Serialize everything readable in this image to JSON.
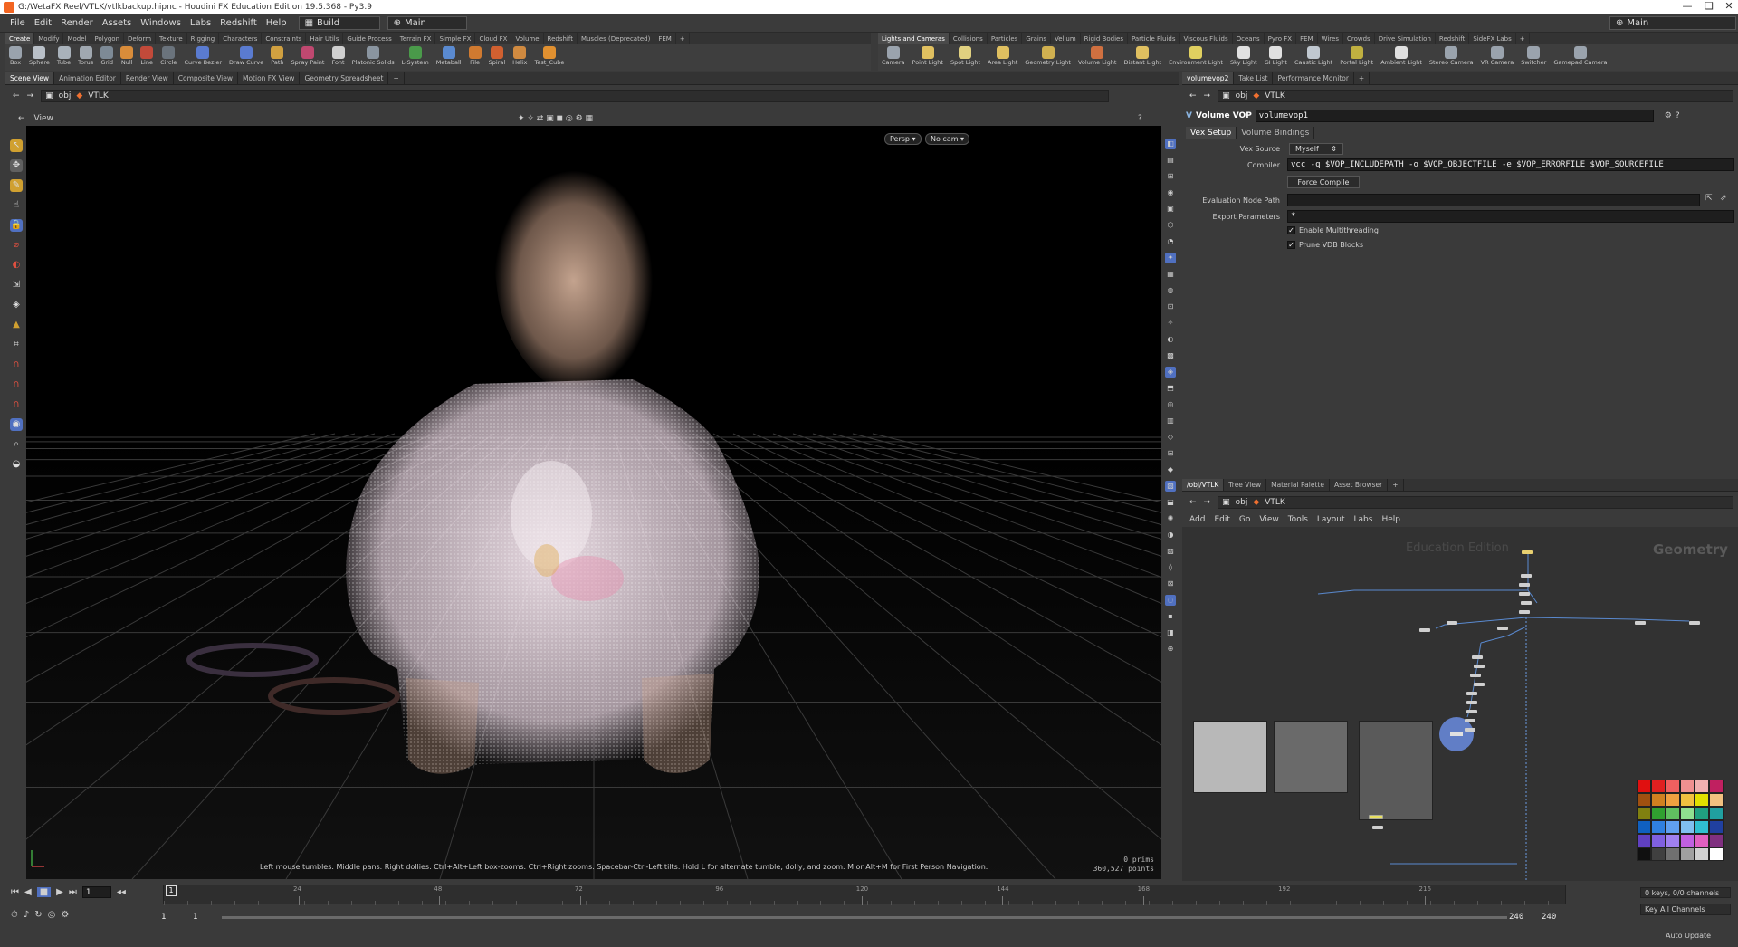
{
  "window": {
    "title": "G:/WetaFX Reel/VTLK/vtlkbackup.hipnc - Houdini FX Education Edition 19.5.368 - Py3.9",
    "controls": [
      "—",
      "❏",
      "✕"
    ]
  },
  "menubar": {
    "items": [
      "File",
      "Edit",
      "Render",
      "Assets",
      "Windows",
      "Labs",
      "Redshift",
      "Help"
    ],
    "desktop": "Build",
    "main": "Main",
    "main_right": "Main"
  },
  "shelf_tabs_left": [
    "Create",
    "Modify",
    "Model",
    "Polygon",
    "Deform",
    "Texture",
    "Rigging",
    "Characters",
    "Constraints",
    "Hair Utils",
    "Guide Process",
    "Terrain FX",
    "Simple FX",
    "Cloud FX",
    "Volume",
    "Redshift",
    "Muscles (Deprecated)",
    "FEM",
    "+"
  ],
  "shelf_tabs_right": [
    "Lights and Cameras",
    "Collisions",
    "Particles",
    "Grains",
    "Vellum",
    "Rigid Bodies",
    "Particle Fluids",
    "Viscous Fluids",
    "Oceans",
    "Pyro FX",
    "FEM",
    "Wires",
    "Crowds",
    "Drive Simulation",
    "Redshift",
    "SideFX Labs",
    "+"
  ],
  "shelf_tools_left": [
    {
      "label": "Box",
      "color": "#9aa3ad"
    },
    {
      "label": "Sphere",
      "color": "#b9c0c8"
    },
    {
      "label": "Tube",
      "color": "#a9b2bb"
    },
    {
      "label": "Torus",
      "color": "#a0a8b0"
    },
    {
      "label": "Grid",
      "color": "#7d8a96"
    },
    {
      "label": "Null",
      "color": "#d98c3a"
    },
    {
      "label": "Line",
      "color": "#c24a3a"
    },
    {
      "label": "Circle",
      "color": "#6a737c"
    },
    {
      "label": "Curve Bezier",
      "color": "#5a7bd0"
    },
    {
      "label": "Draw Curve",
      "color": "#5a7bd0"
    },
    {
      "label": "Path",
      "color": "#d0a040"
    },
    {
      "label": "Spray Paint",
      "color": "#c04870"
    },
    {
      "label": "Font",
      "color": "#d0d0d0"
    },
    {
      "label": "Platonic Solids",
      "color": "#8a95a0"
    },
    {
      "label": "L-System",
      "color": "#4a9a4a"
    },
    {
      "label": "Metaball",
      "color": "#5a8ad0"
    },
    {
      "label": "File",
      "color": "#d07a30"
    },
    {
      "label": "Spiral",
      "color": "#d06030"
    },
    {
      "label": "Helix",
      "color": "#d08a40"
    },
    {
      "label": "Test_Cube",
      "color": "#e09030"
    }
  ],
  "shelf_tools_right": [
    {
      "label": "Camera",
      "color": "#9aa3ad"
    },
    {
      "label": "Point Light",
      "color": "#e0c060"
    },
    {
      "label": "Spot Light",
      "color": "#e0d080"
    },
    {
      "label": "Area Light",
      "color": "#e0c060"
    },
    {
      "label": "Geometry Light",
      "color": "#d0b050"
    },
    {
      "label": "Volume Light",
      "color": "#d07040"
    },
    {
      "label": "Distant Light",
      "color": "#e0c060"
    },
    {
      "label": "Environment Light",
      "color": "#e0d060"
    },
    {
      "label": "Sky Light",
      "color": "#e0e0e0"
    },
    {
      "label": "GI Light",
      "color": "#e0e0e0"
    },
    {
      "label": "Caustic Light",
      "color": "#c0c8d0"
    },
    {
      "label": "Portal Light",
      "color": "#c0b040"
    },
    {
      "label": "Ambient Light",
      "color": "#e0e0e0"
    },
    {
      "label": "Stereo Camera",
      "color": "#9aa3ad"
    },
    {
      "label": "VR Camera",
      "color": "#9aa3ad"
    },
    {
      "label": "Switcher",
      "color": "#9aa3ad"
    },
    {
      "label": "Gamepad Camera",
      "color": "#9aa3ad"
    }
  ],
  "left_pane_tabs": [
    "Scene View",
    "Animation Editor",
    "Render View",
    "Composite View",
    "Motion FX View",
    "Geometry Spreadsheet",
    "+"
  ],
  "left_path": {
    "context": "obj",
    "node": "VTLK"
  },
  "viewport": {
    "label": "View",
    "persp": "Persp ▾",
    "cam": "No cam ▾",
    "help": "Left mouse tumbles. Middle pans. Right dollies. Ctrl+Alt+Left box-zooms. Ctrl+Right zooms. Spacebar-Ctrl-Left tilts. Hold L for alternate tumble, dolly, and zoom.    M or Alt+M for First Person Navigation.",
    "stats_prims": "0  prims",
    "stats_points": "360,527 points"
  },
  "param_tabs": [
    "volumevop2",
    "Take List",
    "Performance Monitor",
    "+"
  ],
  "param_path": {
    "context": "obj",
    "node": "VTLK"
  },
  "param_header": {
    "type": "Volume VOP",
    "name": "volumevop1"
  },
  "param_subtabs": [
    "Vex Setup",
    "Volume Bindings"
  ],
  "params": {
    "vex_source_label": "Vex Source",
    "vex_source": "Myself",
    "compiler_label": "Compiler",
    "compiler": "vcc -q $VOP_INCLUDEPATH -o $VOP_OBJECTFILE -e $VOP_ERRORFILE $VOP_SOURCEFILE",
    "force_compile": "Force Compile",
    "eval_path_label": "Evaluation Node Path",
    "eval_path": "",
    "export_label": "Export Parameters",
    "export": "*",
    "multithread": "Enable Multithreading",
    "prune": "Prune VDB Blocks"
  },
  "net_tabs": [
    "/obj/VTLK",
    "Tree View",
    "Material Palette",
    "Asset Browser",
    "+"
  ],
  "net_path": {
    "context": "obj",
    "node": "VTLK"
  },
  "net_menu": [
    "Add",
    "Edit",
    "Go",
    "View",
    "Tools",
    "Layout",
    "Labs",
    "Help"
  ],
  "net_watermark": "Education Edition",
  "net_context": "Geometry",
  "timeline": {
    "frame": "1",
    "ticks": [
      "24",
      "48",
      "72",
      "96",
      "120",
      "144",
      "168",
      "192",
      "216"
    ],
    "start": "1",
    "start2": "1",
    "end": "240",
    "end2": "240",
    "keys": "0 keys, 0/0 channels",
    "key_all": "Key All Channels",
    "auto_update": "Auto Update"
  },
  "palette": [
    "#e01010",
    "#e02020",
    "#f06060",
    "#f09090",
    "#f0b0b0",
    "#c02060",
    "#a05010",
    "#d08020",
    "#f0a040",
    "#f0c040",
    "#e0e000",
    "#f0c080",
    "#808010",
    "#30a030",
    "#60c060",
    "#90e090",
    "#20a080",
    "#20a0a0",
    "#1060c0",
    "#3080e0",
    "#60a0f0",
    "#80c0f0",
    "#30c0d0",
    "#2040a0",
    "#6040c0",
    "#8060e0",
    "#a080f0",
    "#c060e0",
    "#e060c0",
    "#803080",
    "#101010",
    "#404040",
    "#707070",
    "#a0a0a0",
    "#d0d0d0",
    "#ffffff"
  ]
}
